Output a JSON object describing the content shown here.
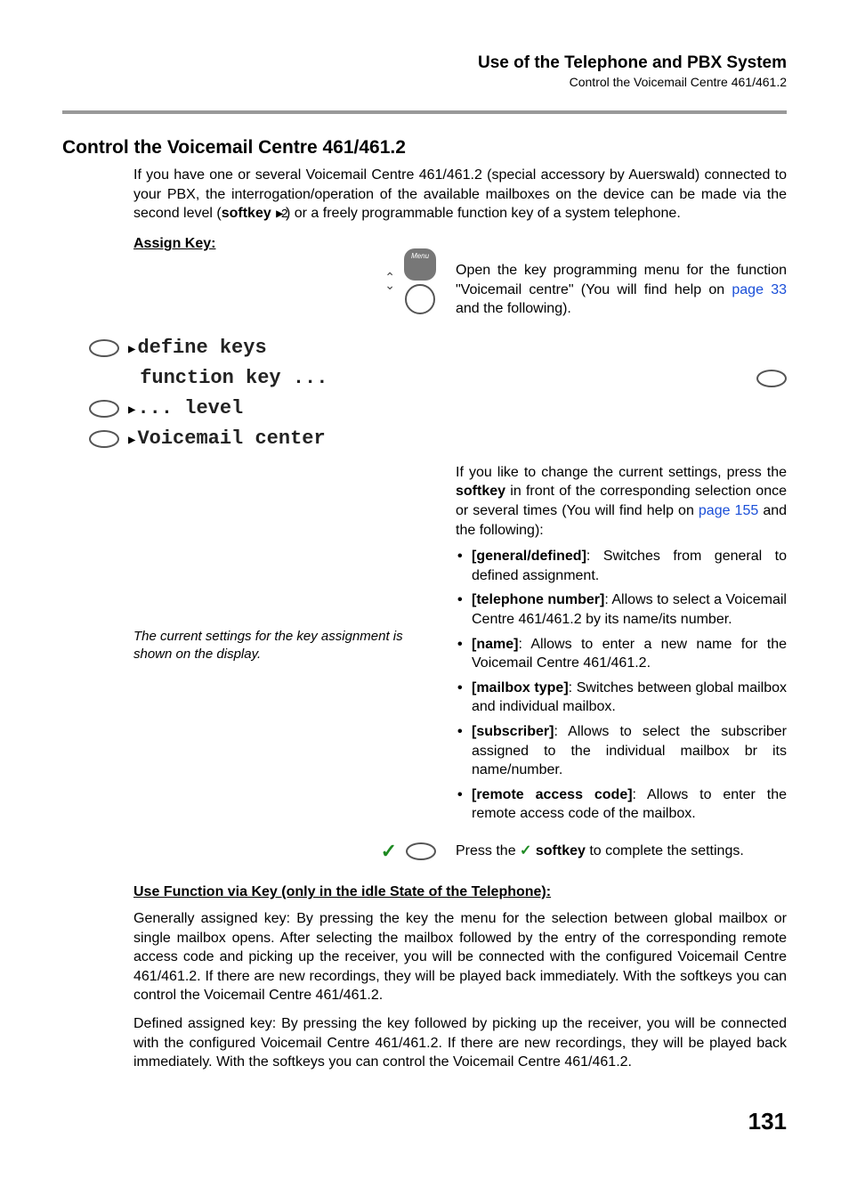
{
  "header": {
    "title": "Use of the Telephone and PBX System",
    "subtitle": "Control the Voicemail Centre 461/461.2"
  },
  "section": {
    "heading": "Control the Voicemail Centre 461/461.2",
    "intro_pre": "If you have one or several Voicemail Centre 461/461.2 (special accessory by Auerswald) connected to your PBX, the interrogation/operation of the available mailboxes on the device can be made via the second level (",
    "intro_softkey": "softkey",
    "intro_post": ") or a freely programmable function key of a system telephone."
  },
  "assign": {
    "heading": "Assign Key:",
    "menu_label": "Menu",
    "open_pre": "Open the key programming menu for the function \"Voicemail centre\" (You will find help on ",
    "open_link": "page 33",
    "open_post": " and the following).",
    "row_define": "define keys",
    "row_function": "function key ...",
    "row_level": "... level",
    "row_voicemail": "Voicemail center",
    "note": "The current settings for the key assignment is shown on the display.",
    "change_pre": "If you like to change the current settings, press the ",
    "change_softkey": "softkey",
    "change_mid": " in front of the corresponding selection once or several times (You will find help on ",
    "change_link": "page 155",
    "change_post": " and the following):",
    "bullets": [
      {
        "label": "[general/defined]",
        "text": ": Switches from general to defined assignment."
      },
      {
        "label": "[telephone number]",
        "text": ": Allows to select a Voicemail Centre 461/461.2 by its name/its number."
      },
      {
        "label": "[name]",
        "text": ": Allows to enter a new name for the Voicemail Centre 461/461.2."
      },
      {
        "label": "[mailbox type]",
        "text": ": Switches between global mailbox and individual mailbox."
      },
      {
        "label": "[subscriber]",
        "text": ": Allows to select the subscriber assigned to the individual mailbox br its name/number."
      },
      {
        "label": "[remote access code]",
        "text": ": Allows to enter the remote access code of the mailbox."
      }
    ],
    "press_pre": "Press the ",
    "press_soft": " softkey",
    "press_post": " to complete the settings."
  },
  "usefn": {
    "heading": "Use Function via Key (only in the idle State of the Telephone):",
    "p1": "Generally assigned key: By pressing the key the menu for the selection between global mailbox or single mailbox opens. After selecting the mailbox followed by the entry of the corresponding remote access code and picking up the receiver, you will be connected with the configured Voicemail Centre 461/461.2. If there are new recordings, they will be played back immediately. With the softkeys you can control the Voicemail Centre 461/461.2.",
    "p2": "Defined assigned key: By pressing the key followed by picking up the receiver, you will be connected with the configured Voicemail Centre 461/461.2. If there are new recordings, they will be played back immediately. With the softkeys you can control the Voicemail Centre 461/461.2."
  },
  "page_number": "131"
}
